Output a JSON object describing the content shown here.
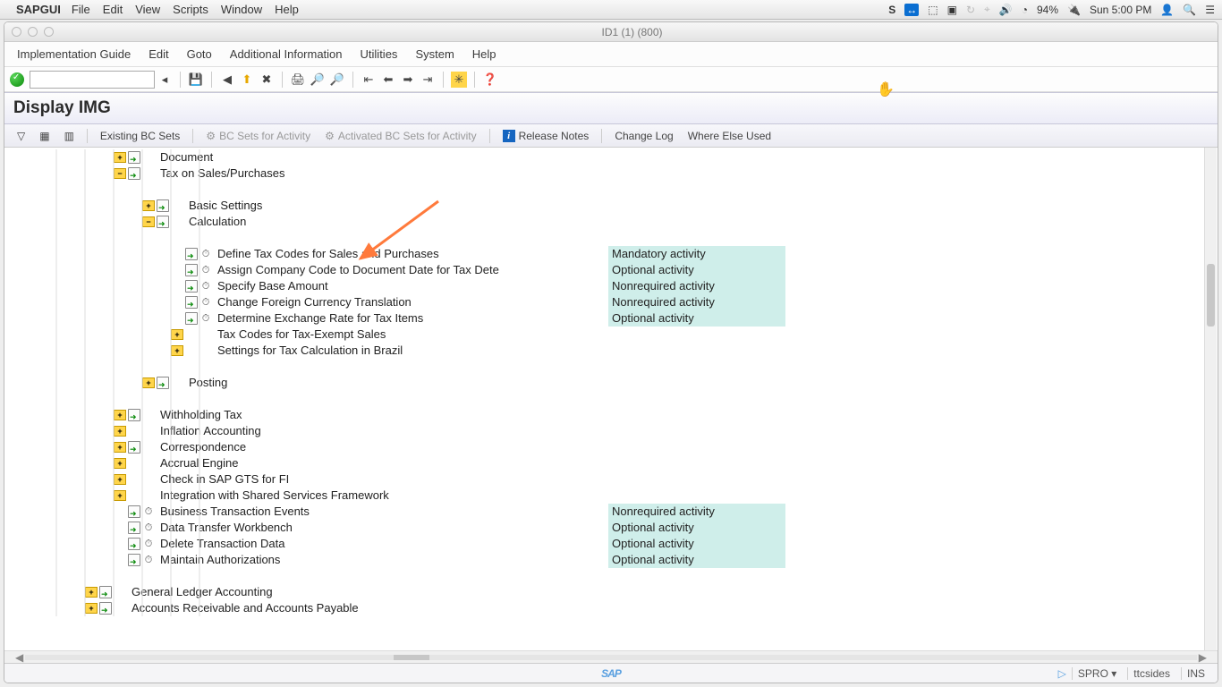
{
  "mac": {
    "app": "SAPGUI",
    "menus": [
      "File",
      "Edit",
      "View",
      "Scripts",
      "Window",
      "Help"
    ],
    "battery": "94%",
    "clock": "Sun 5:00 PM"
  },
  "window": {
    "title": "ID1 (1) (800)"
  },
  "sapmenu": [
    "Implementation Guide",
    "Edit",
    "Goto",
    "Additional Information",
    "Utilities",
    "System",
    "Help"
  ],
  "cmd_placeholder": "",
  "panel_title": "Display IMG",
  "subtb": {
    "existing": "Existing BC Sets",
    "for_activity": "BC Sets for Activity",
    "activated": "Activated BC Sets for Activity",
    "release": "Release Notes",
    "changelog": "Change Log",
    "where": "Where Else Used"
  },
  "tree": {
    "r1": {
      "exp": "plus",
      "icons": [
        "arrow"
      ],
      "label": "Document",
      "ind": 3
    },
    "r2": {
      "exp": "minus",
      "icons": [
        "arrow"
      ],
      "label": "Tax on Sales/Purchases",
      "ind": 3
    },
    "r3": {
      "exp": "plus",
      "icons": [
        "arrow"
      ],
      "label": "Basic Settings",
      "ind": 4
    },
    "r4": {
      "exp": "minus",
      "icons": [
        "arrow"
      ],
      "label": "Calculation",
      "ind": 4
    },
    "r5": {
      "exp": "",
      "icons": [
        "arrow",
        "clock"
      ],
      "label": "Define Tax Codes for Sales and Purchases",
      "activity": "Mandatory activity",
      "ind": 5
    },
    "r6": {
      "exp": "",
      "icons": [
        "arrow",
        "clock"
      ],
      "label": "Assign Company Code to Document Date for Tax Dete",
      "activity": "Optional activity",
      "ind": 5,
      "trunc": true
    },
    "r7": {
      "exp": "",
      "icons": [
        "arrow",
        "clock"
      ],
      "label": "Specify Base Amount",
      "activity": "Nonrequired activity",
      "ind": 5
    },
    "r8": {
      "exp": "",
      "icons": [
        "arrow",
        "clock"
      ],
      "label": "Change Foreign Currency Translation",
      "activity": "Nonrequired activity",
      "ind": 5
    },
    "r9": {
      "exp": "",
      "icons": [
        "arrow",
        "clock"
      ],
      "label": "Determine Exchange Rate for Tax Items",
      "activity": "Optional activity",
      "ind": 5
    },
    "r10": {
      "exp": "plus",
      "icons": [],
      "label": "Tax Codes for Tax-Exempt Sales",
      "ind": 5
    },
    "r11": {
      "exp": "plus",
      "icons": [],
      "label": "Settings for Tax Calculation in Brazil",
      "ind": 5
    },
    "r12": {
      "exp": "plus",
      "icons": [
        "arrow"
      ],
      "label": "Posting",
      "ind": 4
    },
    "r13": {
      "exp": "plus",
      "icons": [
        "arrow"
      ],
      "label": "Withholding Tax",
      "ind": 3
    },
    "r14": {
      "exp": "plus",
      "icons": [],
      "label": "Inflation Accounting",
      "ind": 3
    },
    "r15": {
      "exp": "plus",
      "icons": [
        "arrow"
      ],
      "label": "Correspondence",
      "ind": 3
    },
    "r16": {
      "exp": "plus",
      "icons": [],
      "label": "Accrual Engine",
      "ind": 3
    },
    "r17": {
      "exp": "plus",
      "icons": [],
      "label": "Check in SAP GTS for FI",
      "ind": 3
    },
    "r18": {
      "exp": "plus",
      "icons": [],
      "label": "Integration with Shared Services Framework",
      "ind": 3
    },
    "r19": {
      "exp": "",
      "icons": [
        "arrow",
        "clock"
      ],
      "label": "Business Transaction Events",
      "activity": "Nonrequired activity",
      "ind": 3
    },
    "r20": {
      "exp": "",
      "icons": [
        "arrow",
        "clock"
      ],
      "label": "Data Transfer Workbench",
      "activity": "Optional activity",
      "ind": 3
    },
    "r21": {
      "exp": "",
      "icons": [
        "arrow",
        "clock"
      ],
      "label": "Delete Transaction Data",
      "activity": "Optional activity",
      "ind": 3
    },
    "r22": {
      "exp": "",
      "icons": [
        "arrow",
        "clock"
      ],
      "label": "Maintain Authorizations",
      "activity": "Optional activity",
      "ind": 3
    },
    "r23": {
      "exp": "plus",
      "icons": [
        "arrow"
      ],
      "label": "General Ledger Accounting",
      "ind": 2
    },
    "r24": {
      "exp": "plus",
      "icons": [
        "arrow"
      ],
      "label": "Accounts Receivable and Accounts Payable",
      "ind": 2
    }
  },
  "status": {
    "tcode": "SPRO",
    "dd": "▾",
    "user": "ttcsides",
    "ins": "INS"
  }
}
